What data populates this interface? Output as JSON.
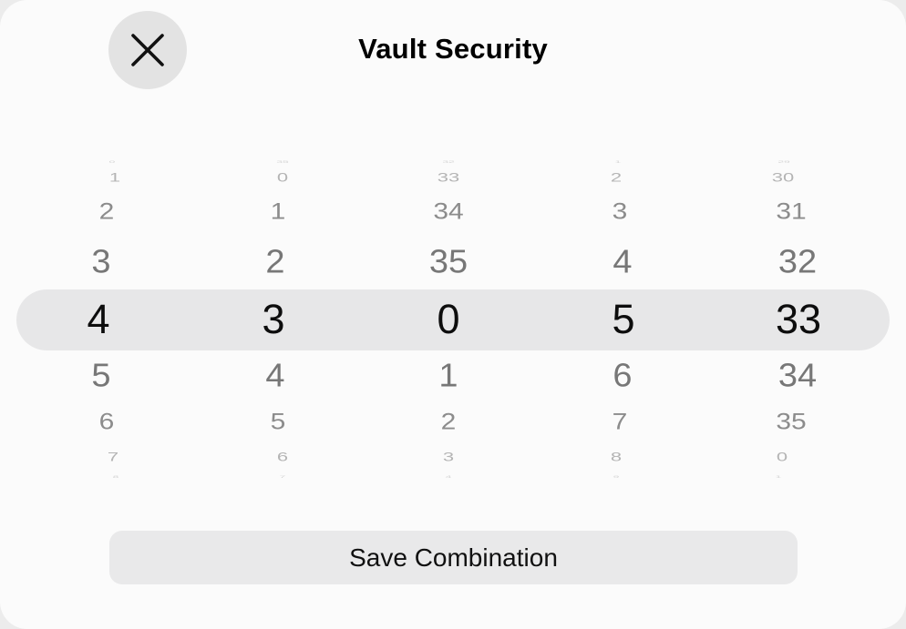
{
  "header": {
    "title": "Vault Security",
    "close_icon": "close-icon"
  },
  "picker": {
    "selected": [
      "4",
      "3",
      "0",
      "5",
      "33"
    ],
    "wheels": [
      {
        "rows": [
          "0",
          "1",
          "2",
          "3",
          "4",
          "5",
          "6",
          "7",
          "8"
        ]
      },
      {
        "rows": [
          "35",
          "0",
          "1",
          "2",
          "3",
          "4",
          "5",
          "6",
          "7"
        ]
      },
      {
        "rows": [
          "32",
          "33",
          "34",
          "35",
          "0",
          "1",
          "2",
          "3",
          "4"
        ]
      },
      {
        "rows": [
          "1",
          "2",
          "3",
          "4",
          "5",
          "6",
          "7",
          "8",
          "9"
        ]
      },
      {
        "rows": [
          "29",
          "30",
          "31",
          "32",
          "33",
          "34",
          "35",
          "0",
          "1"
        ]
      }
    ]
  },
  "actions": {
    "save_label": "Save Combination"
  },
  "colors": {
    "background": "#fbfbfb",
    "selection_band": "#e7e7e8",
    "button_fill": "#e9e9ea",
    "selected_text": "#0d0d0d",
    "dim_text": "#777777"
  }
}
